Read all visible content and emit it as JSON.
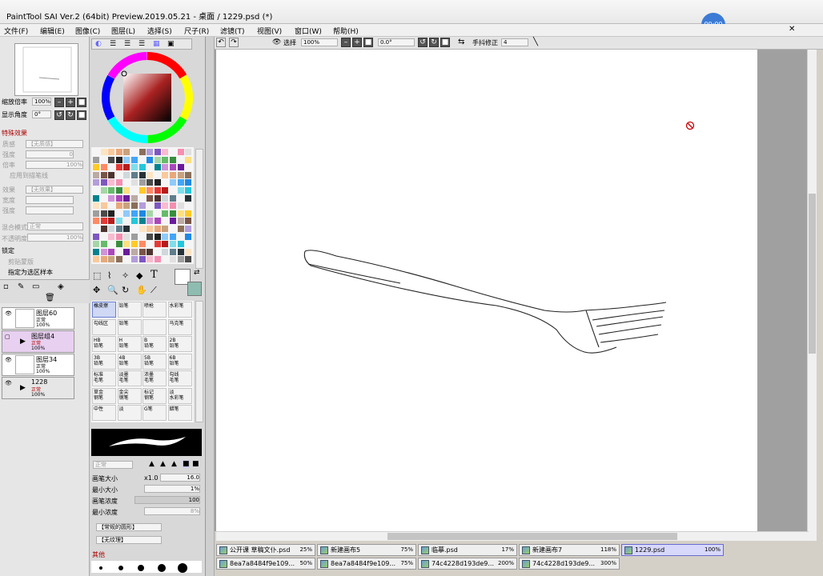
{
  "window": {
    "title": "PaintTool SAI Ver.2 (64bit) Preview.2019.05.21 - 桌面 / 1229.psd (*)",
    "timer": "00:00"
  },
  "menu": [
    "文件(F)",
    "编辑(E)",
    "图像(C)",
    "图层(L)",
    "选择(S)",
    "尺子(R)",
    "滤镜(T)",
    "视图(V)",
    "窗口(W)",
    "帮助(H)"
  ],
  "navigator": {
    "zoom_label": "缩放倍率",
    "zoom_value": "100%",
    "angle_label": "显示角度",
    "angle_value": "0°"
  },
  "effects": {
    "header": "特殊效果",
    "texture_label": "质感",
    "texture_value": "【无质感】",
    "scale_label": "倍率",
    "scale_value": "100%",
    "strength_label": "强度",
    "strength_value": "0",
    "apply_border": "应用到描笔线",
    "effect_label": "效果",
    "effect_value": "【无效果】",
    "width_label": "宽度",
    "strength2_label": "强度",
    "blend_label": "混合模式",
    "blend_value": "正常",
    "opacity_label": "不透明度",
    "opacity_value": "100%",
    "lock_label": "锁定",
    "clip_label": "剪贴蒙版",
    "select_source": "指定为选区样本"
  },
  "layers": [
    {
      "name": "图层60",
      "mode": "正常",
      "opacity": "100%"
    },
    {
      "name": "图层组4",
      "mode": "正常",
      "opacity": "100%"
    },
    {
      "name": "图层34",
      "mode": "正常",
      "opacity": "100%"
    },
    {
      "name": "1228",
      "mode": "正常",
      "opacity": "100%"
    }
  ],
  "tools": [
    [
      "橡皮擦",
      "铅笔",
      "喷枪",
      "水彩笔"
    ],
    [
      "勾线区",
      "铅笔",
      "",
      "马克笔"
    ],
    [
      "HB\n铅笔",
      "H\n铅笔",
      "B\n铅笔",
      "2B\n铅笔"
    ],
    [
      "3B\n铅笔",
      "4B\n铅笔",
      "5B\n铅笔",
      "6B\n铅笔"
    ],
    [
      "标准\n毛笔",
      "淡墨\n毛笔",
      "浓墨\n毛笔",
      "勾线\n毛笔"
    ],
    [
      "草金\n钢笔",
      "金尖\n钢笔",
      "标记\n钢笔",
      "淡\n水彩笔"
    ],
    [
      "中性",
      "淡",
      "G笔",
      "蜡笔"
    ]
  ],
  "brush": {
    "mode": "正常",
    "size_label": "画笔大小",
    "size_mult": "x1.0",
    "size_value": "16.0",
    "min_size_label": "最小大小",
    "min_size_value": "1%",
    "density_label": "画笔浓度",
    "density_value": "100",
    "min_density_label": "最小浓度",
    "min_density_value": "8%",
    "shape_value": "【常规的圆形】",
    "texture_value": "【无纹理】",
    "other_label": "其他"
  },
  "canvas_toolbar": {
    "select_label": "选择",
    "zoom": "100%",
    "angle": "0.0°",
    "stabilizer_label": "手抖修正",
    "stabilizer_value": "4"
  },
  "file_tabs": [
    {
      "name": "公开课 草稿文仆.psd",
      "zoom": "25%"
    },
    {
      "name": "新建画布5",
      "zoom": "75%"
    },
    {
      "name": "临摹.psd",
      "zoom": "17%"
    },
    {
      "name": "新建画布7",
      "zoom": "118%"
    },
    {
      "name": "1229.psd",
      "zoom": "100%"
    },
    {
      "name": "8ea7a8484f9e109...",
      "zoom": "50%"
    },
    {
      "name": "8ea7a8484f9e109...",
      "zoom": "75%"
    },
    {
      "name": "74c4228d193de9...",
      "zoom": "200%"
    },
    {
      "name": "74c4228d193de9...",
      "zoom": "300%"
    }
  ],
  "colors": {
    "accent": "#3b7bd6",
    "swatch_selected": "#8fbcb0"
  }
}
